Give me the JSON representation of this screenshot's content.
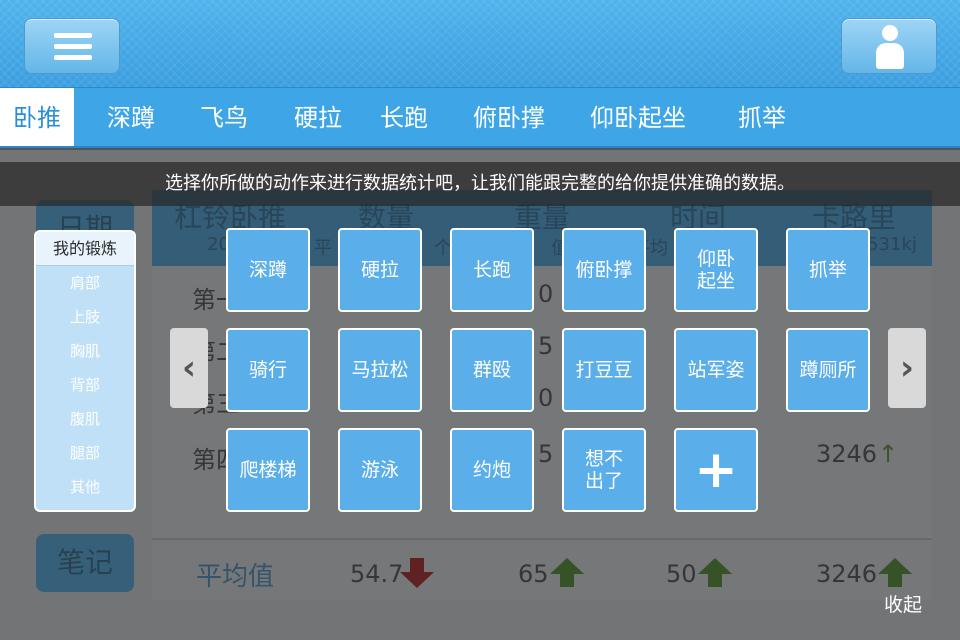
{
  "header": {
    "menu_icon": "hamburger-menu-icon",
    "user_icon": "user-profile-icon"
  },
  "tabs": [
    {
      "label": "卧推",
      "active": true
    },
    {
      "label": "深蹲"
    },
    {
      "label": "飞鸟"
    },
    {
      "label": "硬拉"
    },
    {
      "label": "长跑"
    },
    {
      "label": "俯卧撑"
    },
    {
      "label": "仰卧起坐"
    },
    {
      "label": "抓举"
    }
  ],
  "hint": "选择你所做的动作来进行数据统计吧，让我们能跟完整的给你提供准确的数据。",
  "background": {
    "side_buttons": {
      "date": "日期",
      "notes": "笔记"
    },
    "table": {
      "title": "杠铃卧推",
      "title_date": "2013",
      "headers": [
        "数量",
        "重量",
        "时间",
        "卡路里"
      ],
      "header_subs": [
        "平",
        "个",
        "值6",
        "平均",
        "531kj"
      ],
      "rows": [
        "第一",
        "第二",
        "第三",
        "第四"
      ],
      "row_values": [
        "0",
        "5",
        "0",
        "5",
        "3246"
      ],
      "avg_label": "平均值",
      "avg_values": [
        "54.7",
        "65",
        "50",
        "3246"
      ]
    }
  },
  "category_panel": {
    "header": "我的锻炼",
    "items": [
      "肩部",
      "上肢",
      "胸肌",
      "背部",
      "腹肌",
      "腿部",
      "其他"
    ]
  },
  "exercises": {
    "row1": [
      "深蹲",
      "硬拉",
      "长跑",
      "俯卧撑",
      "仰卧\n起坐",
      "抓举"
    ],
    "row2": [
      "骑行",
      "马拉松",
      "群殴",
      "打豆豆",
      "站军姿",
      "蹲厕所"
    ],
    "row3": [
      "爬楼梯",
      "游泳",
      "约炮",
      "想不\n出了",
      "+"
    ]
  },
  "nav": {
    "prev": "‹",
    "next": "›"
  },
  "collapse_label": "收起",
  "colors": {
    "accent": "#3ea6e7",
    "tile": "#5aaeea"
  }
}
